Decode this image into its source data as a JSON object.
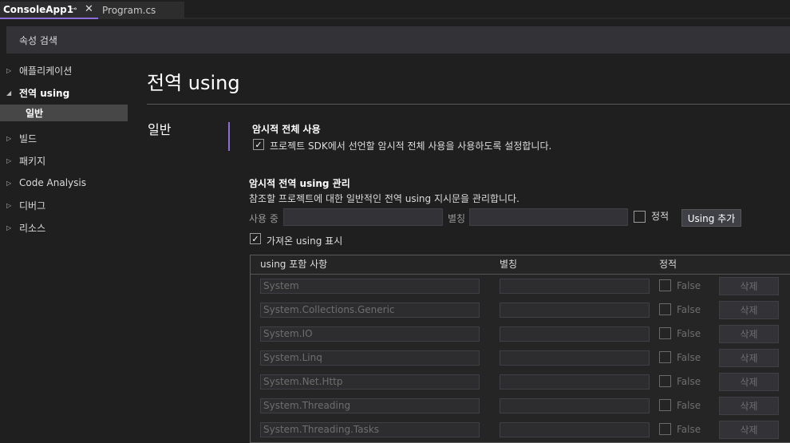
{
  "tabs": {
    "active_label": "ConsoleApp1",
    "pin_glyph": "⊸",
    "close_glyph": "✕",
    "second_label": "Program.cs"
  },
  "search": {
    "label": "속성 검색"
  },
  "sidebar": {
    "items": [
      {
        "label": "애플리케이션",
        "expanded": false
      },
      {
        "label": "전역 using",
        "expanded": true
      },
      {
        "label": "일반",
        "selected": true
      },
      {
        "label": "빌드",
        "expanded": false
      },
      {
        "label": "패키지",
        "expanded": false
      },
      {
        "label": "Code Analysis",
        "expanded": false
      },
      {
        "label": "디버그",
        "expanded": false
      },
      {
        "label": "리소스",
        "expanded": false
      }
    ]
  },
  "main": {
    "title": "전역 using",
    "section": "일반",
    "implicit": {
      "heading": "암시적 전체 사용",
      "checkbox_label": "프로젝트 SDK에서 선언할 암시적 전체 사용을 사용하도록 설정합니다.",
      "checked": true
    },
    "manage": {
      "heading": "암시적 전역 using 관리",
      "description": "참조할 프로젝트에 대한 일반적인 전역 using 지시문을 관리합니다.",
      "using_label": "사용 중",
      "alias_label": "별칭",
      "static_label": "정적",
      "add_button": "Using 추가",
      "show_imported_label": "가져온 using 표시",
      "show_imported_checked": true
    },
    "table": {
      "headers": [
        "using 포함 사항",
        "별칭",
        "정적"
      ],
      "rows": [
        {
          "using": "System",
          "static": "False",
          "delete": "삭제"
        },
        {
          "using": "System.Collections.Generic",
          "static": "False",
          "delete": "삭제"
        },
        {
          "using": "System.IO",
          "static": "False",
          "delete": "삭제"
        },
        {
          "using": "System.Linq",
          "static": "False",
          "delete": "삭제"
        },
        {
          "using": "System.Net.Http",
          "static": "False",
          "delete": "삭제"
        },
        {
          "using": "System.Threading",
          "static": "False",
          "delete": "삭제"
        },
        {
          "using": "System.Threading.Tasks",
          "static": "False",
          "delete": "삭제"
        }
      ]
    }
  },
  "colors": {
    "accent": "#8b6fd6",
    "background": "#1f1f1f"
  }
}
